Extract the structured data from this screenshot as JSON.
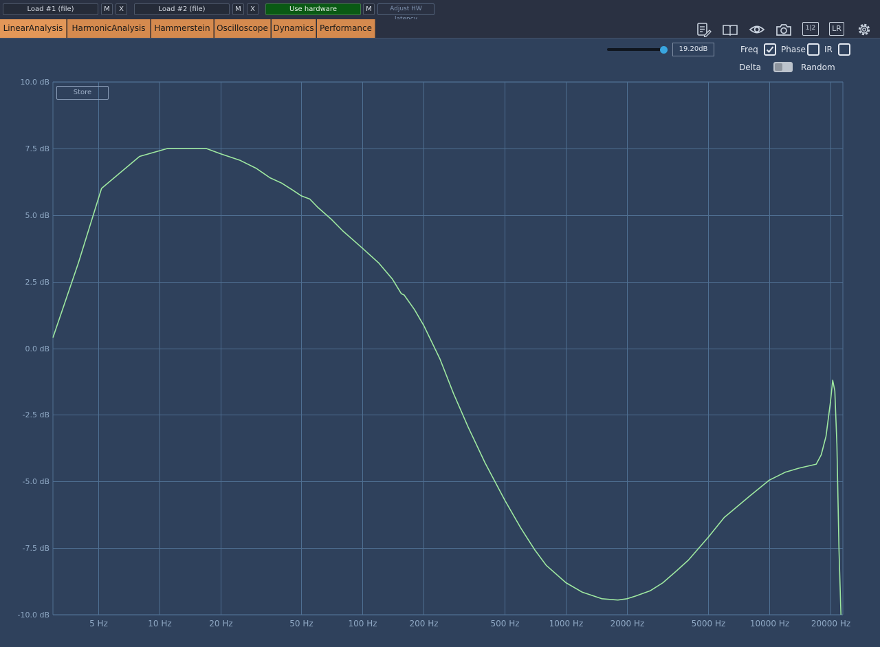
{
  "toolbar": {
    "load1_label": "Load #1 (file)",
    "load2_label": "Load #2 (file)",
    "m_label": "M",
    "x_label": "X",
    "use_hardware_label": "Use hardware",
    "adjust_latency_label": "Adjust HW latency"
  },
  "tabs": [
    "LinearAnalysis",
    "HarmonicAnalysis",
    "Hammerstein",
    "Oscilloscope",
    "Dynamics",
    "Performance"
  ],
  "icons": [
    "notes-icon",
    "book-icon",
    "eye-icon",
    "camera-icon",
    "one-half-icon",
    "lr-icon",
    "gear-icon"
  ],
  "icon_text": {
    "one_half": "1|2",
    "lr": "LR"
  },
  "controls": {
    "range_value": "19.20dB",
    "range_slider_level": 1.0,
    "freq_label": "Freq",
    "freq_checked": true,
    "phase_label": "Phase",
    "phase_checked": false,
    "ir_label": "IR",
    "ir_checked": false,
    "delta_label": "Delta",
    "random_label": "Random",
    "delta_random_toggle": "delta"
  },
  "store_label": "Store",
  "colors": {
    "background": "#2f415c",
    "grid": "#4f6f92",
    "curve": "#9ee8a0",
    "tab": "#d58a4e",
    "hardware_button": "#0a5a14",
    "axis_text": "#8fa8c4"
  },
  "chart_data": {
    "type": "line",
    "x_scale": "log",
    "xlim": [
      3,
      23000
    ],
    "ylim": [
      -10,
      10
    ],
    "grid": true,
    "y_ticks": [
      "10.0 dB",
      "7.5 dB",
      "5.0 dB",
      "2.5 dB",
      "0.0 dB",
      "-2.5 dB",
      "-5.0 dB",
      "-7.5 dB",
      "-10.0 dB"
    ],
    "y_tick_values": [
      10,
      7.5,
      5,
      2.5,
      0,
      -2.5,
      -5,
      -7.5,
      -10
    ],
    "x_ticks": [
      "5 Hz",
      "10 Hz",
      "20 Hz",
      "50 Hz",
      "100 Hz",
      "200 Hz",
      "500 Hz",
      "1000 Hz",
      "2000 Hz",
      "5000 Hz",
      "10000 Hz",
      "20000 Hz"
    ],
    "x_tick_values": [
      5,
      10,
      20,
      50,
      100,
      200,
      500,
      1000,
      2000,
      5000,
      10000,
      20000
    ],
    "series": [
      {
        "x": [
          3,
          4,
          5.2,
          8,
          11,
          14,
          17,
          20,
          25,
          30,
          35,
          40,
          45,
          50,
          55,
          60,
          70,
          80,
          100,
          120,
          140,
          155,
          160,
          180,
          200,
          240,
          280,
          330,
          400,
          500,
          600,
          700,
          800,
          1000,
          1200,
          1500,
          1800,
          2000,
          2200,
          2600,
          3000,
          3500,
          4000,
          5000,
          6000,
          8000,
          10000,
          12000,
          14000,
          17000,
          18000,
          19000,
          20000,
          20500,
          21000,
          21500,
          22000,
          22500
        ],
        "y": [
          0.4,
          3.2,
          6.0,
          7.2,
          7.5,
          7.5,
          7.5,
          7.3,
          7.05,
          6.75,
          6.4,
          6.2,
          5.95,
          5.72,
          5.6,
          5.3,
          4.85,
          4.4,
          3.75,
          3.2,
          2.6,
          2.05,
          2.0,
          1.45,
          0.85,
          -0.4,
          -1.7,
          -2.95,
          -4.3,
          -5.7,
          -6.75,
          -7.55,
          -8.15,
          -8.8,
          -9.15,
          -9.4,
          -9.45,
          -9.4,
          -9.3,
          -9.1,
          -8.8,
          -8.35,
          -7.95,
          -7.1,
          -6.35,
          -5.55,
          -4.95,
          -4.65,
          -4.5,
          -4.35,
          -4.0,
          -3.3,
          -2.0,
          -1.2,
          -1.6,
          -3.6,
          -7.5,
          -10.0
        ]
      }
    ]
  }
}
